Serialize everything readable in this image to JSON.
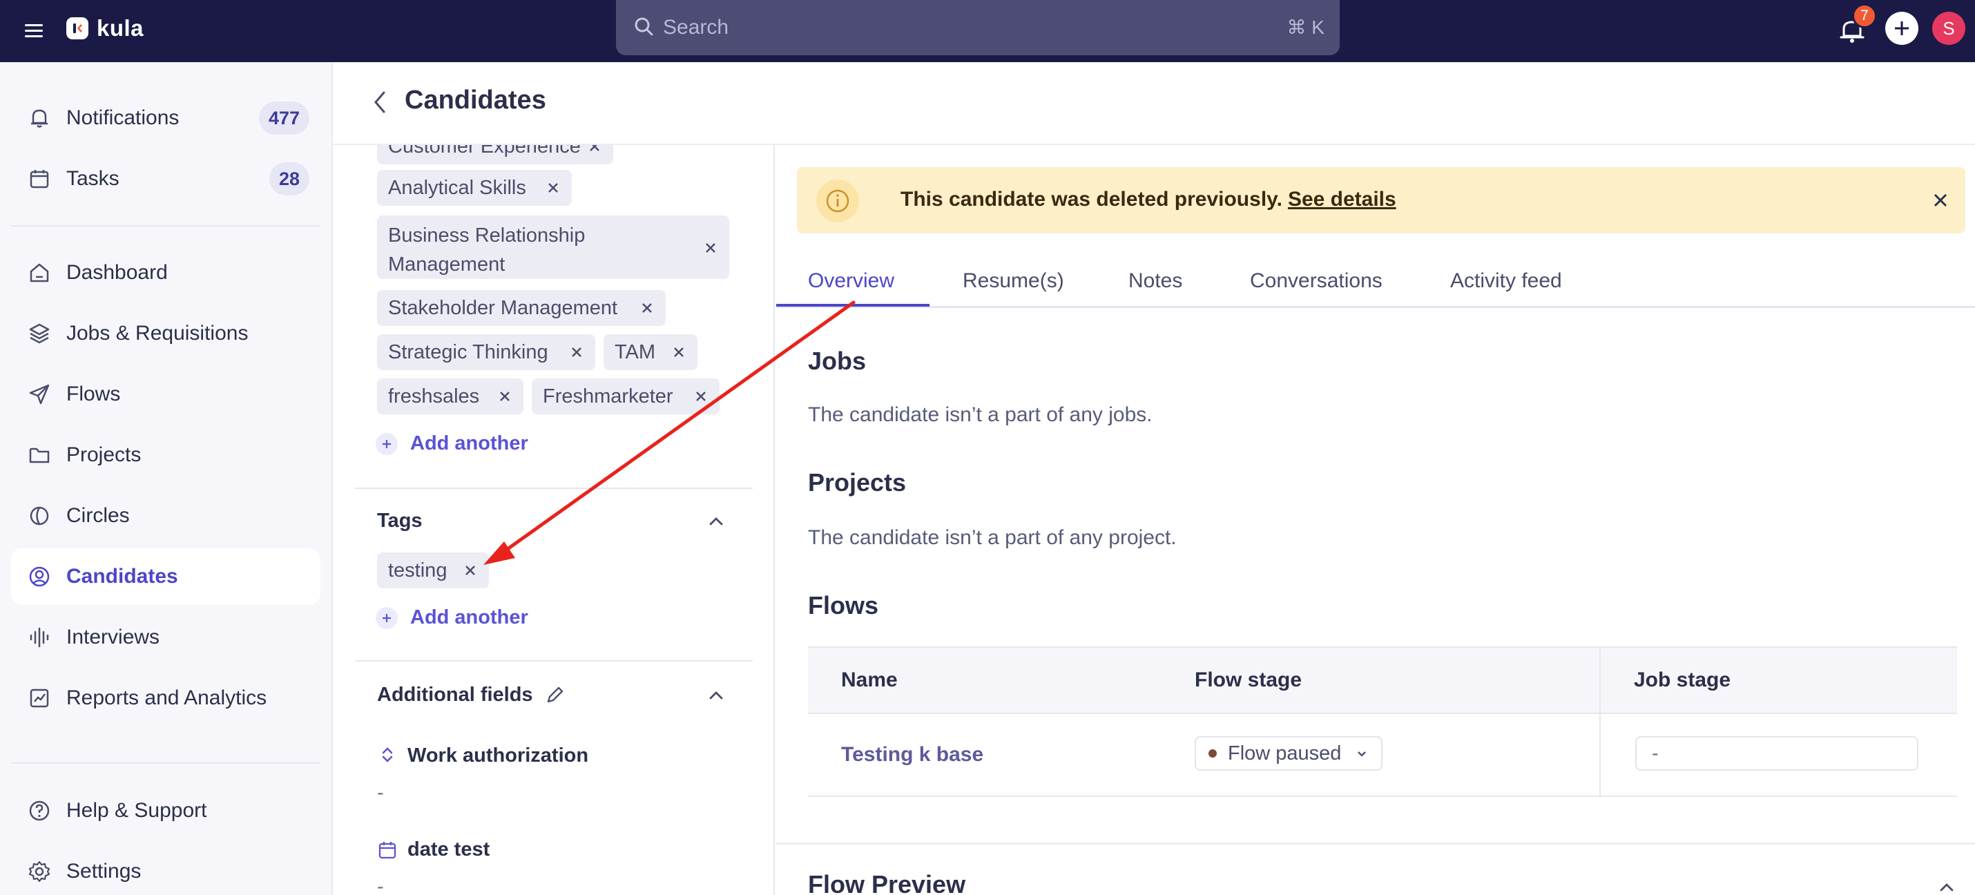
{
  "app": {
    "name": "kula",
    "search_placeholder": "Search",
    "search_shortcut": "⌘ K",
    "notification_badge": "7",
    "avatar_initial": "S"
  },
  "sidebar": {
    "items": [
      {
        "label": "Notifications",
        "count": "477",
        "icon": "bell-icon"
      },
      {
        "label": "Tasks",
        "count": "28",
        "icon": "calendar-icon"
      },
      {
        "label": "Dashboard",
        "icon": "home-icon"
      },
      {
        "label": "Jobs & Requisitions",
        "icon": "layers-icon"
      },
      {
        "label": "Flows",
        "icon": "send-icon"
      },
      {
        "label": "Projects",
        "icon": "folder-icon"
      },
      {
        "label": "Circles",
        "icon": "circle-half-icon"
      },
      {
        "label": "Candidates",
        "icon": "user-circle-icon",
        "active": true
      },
      {
        "label": "Interviews",
        "icon": "audio-wave-icon"
      },
      {
        "label": "Reports and Analytics",
        "icon": "chart-icon"
      },
      {
        "label": "Help & Support",
        "icon": "help-icon"
      },
      {
        "label": "Settings",
        "icon": "gear-icon"
      }
    ]
  },
  "header": {
    "title": "Candidates"
  },
  "skills": {
    "chips": [
      "Customer Experience",
      "Analytical Skills",
      "Business Relationship Management",
      "Stakeholder Management",
      "Strategic Thinking",
      "TAM",
      "freshsales",
      "Freshmarketer"
    ],
    "add_label": "Add another"
  },
  "tags": {
    "title": "Tags",
    "chips": [
      "testing"
    ],
    "add_label": "Add another"
  },
  "additional_fields": {
    "title": "Additional fields",
    "fields": [
      {
        "label": "Work authorization",
        "value": "-"
      },
      {
        "label": "date test",
        "value": "-"
      }
    ]
  },
  "alert": {
    "text": "This candidate was deleted previously.",
    "link": "See details"
  },
  "tabs": [
    "Overview",
    "Resume(s)",
    "Notes",
    "Conversations",
    "Activity feed"
  ],
  "overview": {
    "jobs_title": "Jobs",
    "jobs_text": "The candidate isn’t a part of any jobs.",
    "projects_title": "Projects",
    "projects_text": "The candidate isn’t a part of any project.",
    "flows_title": "Flows",
    "flows_table": {
      "headers": [
        "Name",
        "Flow stage",
        "Job stage"
      ],
      "rows": [
        {
          "name": "Testing k base",
          "flow_stage": "Flow paused",
          "job_stage": "-"
        }
      ]
    },
    "preview_title": "Flow Preview"
  },
  "colors": {
    "topbar": "#1b1a46",
    "accent": "#4b46c8",
    "alert_bg": "#fdf0c8",
    "annotation_arrow": "#e8231b"
  }
}
